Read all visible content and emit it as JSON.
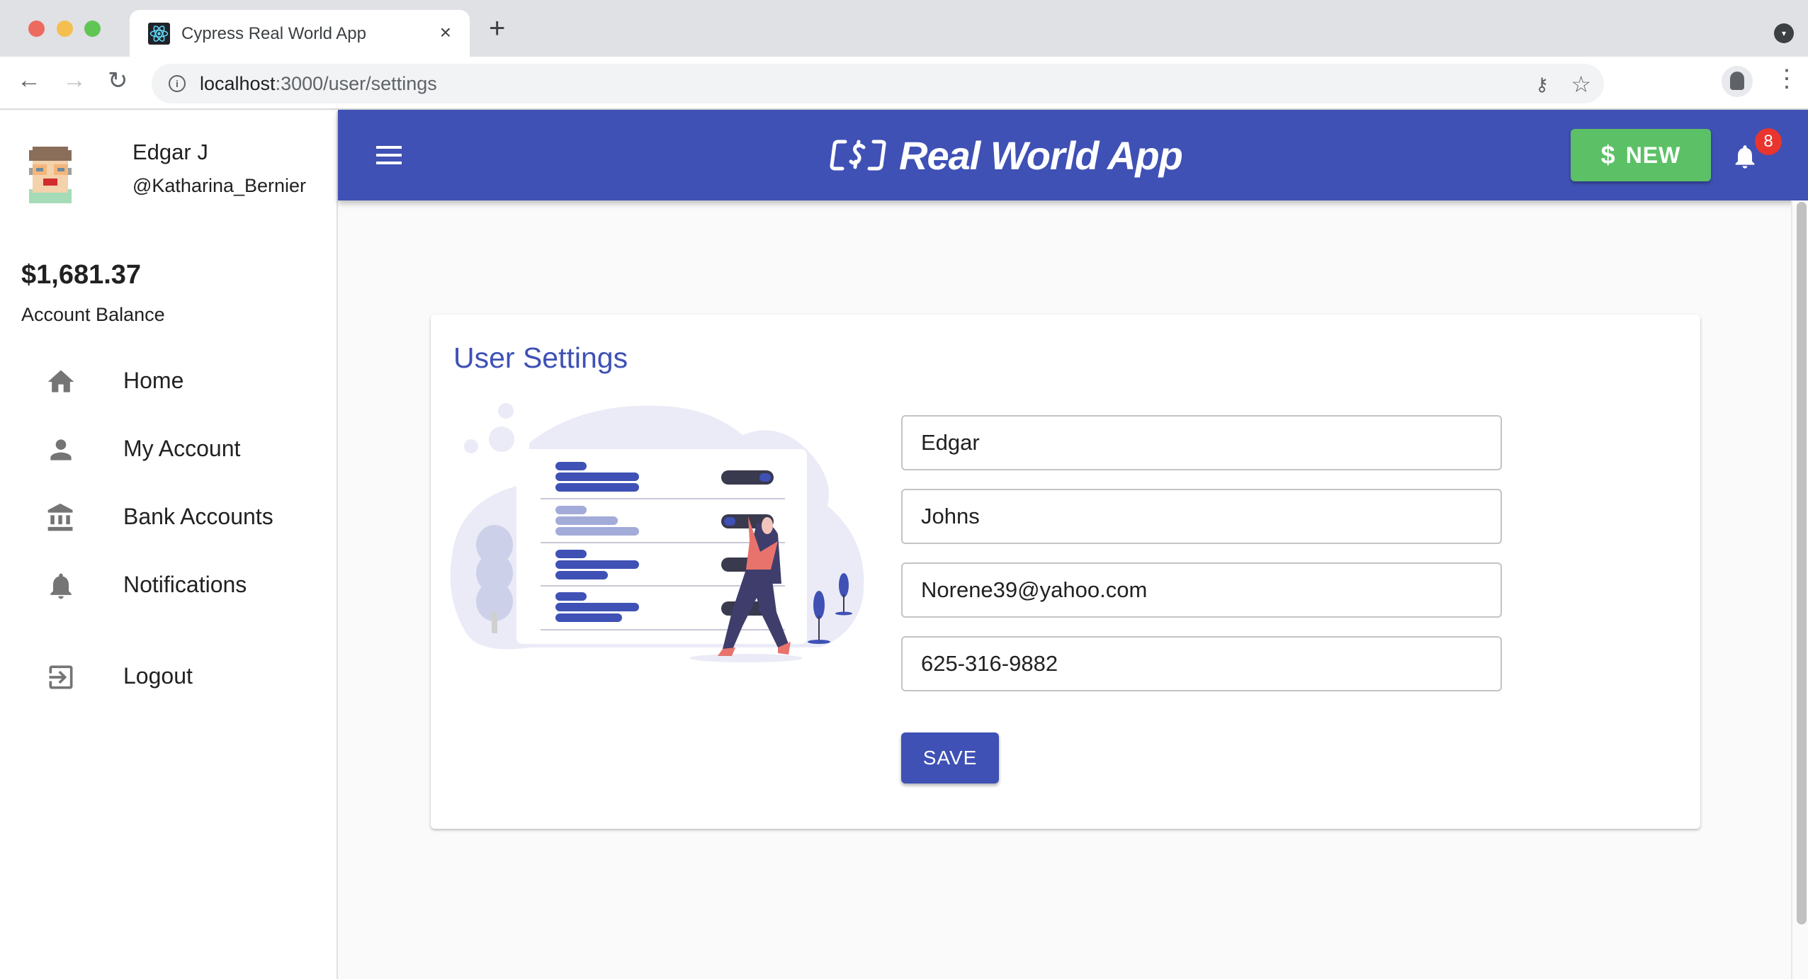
{
  "browser": {
    "tab_title": "Cypress Real World App",
    "tab_close": "×",
    "new_tab": "+",
    "url_host": "localhost",
    "url_path": ":3000/user/settings",
    "back": "←",
    "forward": "→",
    "reload": "↻",
    "key_glyph": "⚷",
    "star_glyph": "☆",
    "menu_glyph": "⋮",
    "tab_search_glyph": "▾"
  },
  "sidebar": {
    "user_name": "Edgar J",
    "user_handle": "@Katharina_Bernier",
    "balance": "$1,681.37",
    "balance_label": "Account Balance",
    "items": [
      {
        "label": "Home",
        "icon": "home-icon"
      },
      {
        "label": "My Account",
        "icon": "person-icon"
      },
      {
        "label": "Bank Accounts",
        "icon": "bank-icon"
      },
      {
        "label": "Notifications",
        "icon": "bell-icon"
      },
      {
        "label": "Logout",
        "icon": "logout-icon"
      }
    ]
  },
  "appbar": {
    "title": "Real World App",
    "new_button_symbol": "$",
    "new_button_label": "NEW",
    "notification_count": "8",
    "colors": {
      "primary": "#3f51b5",
      "new_button": "#5cc166",
      "badge": "#e8352e"
    }
  },
  "settings": {
    "title": "User Settings",
    "fields": {
      "first_name": "Edgar",
      "last_name": "Johns",
      "email": "Norene39@yahoo.com",
      "phone": "625-316-9882"
    },
    "save_label": "SAVE"
  }
}
